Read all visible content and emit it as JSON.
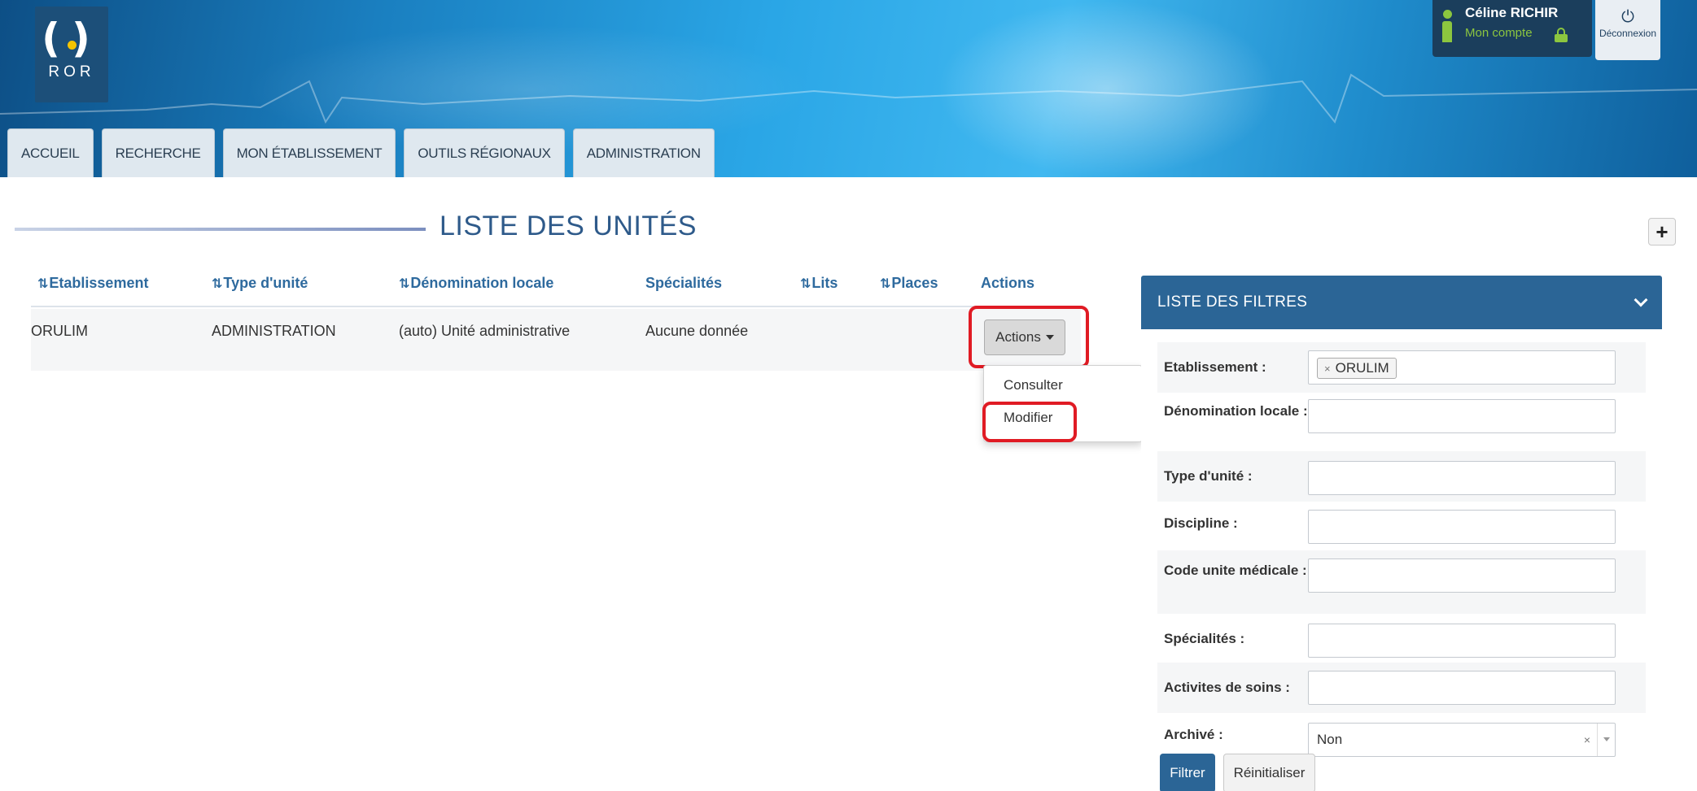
{
  "app": {
    "logo_text": "ROR"
  },
  "user": {
    "name": "Céline RICHIR",
    "account_label": "Mon compte",
    "logout_label": "Déconnexion"
  },
  "nav": {
    "tabs": [
      "ACCUEIL",
      "RECHERCHE",
      "MON ÉTABLISSEMENT",
      "OUTILS RÉGIONAUX",
      "ADMINISTRATION"
    ]
  },
  "page": {
    "title": "LISTE DES UNITÉS",
    "add_label": "+"
  },
  "table": {
    "columns": [
      "Etablissement",
      "Type d'unité",
      "Dénomination locale",
      "Spécialités",
      "Lits",
      "Places",
      "Actions"
    ],
    "rows": [
      {
        "etablissement": "ORULIM",
        "type": "ADMINISTRATION",
        "denomination": "(auto) Unité administrative",
        "specialites": "Aucune donnée",
        "lits": "",
        "places": ""
      }
    ],
    "actions_button": "Actions",
    "actions_menu": [
      "Consulter",
      "Modifier"
    ]
  },
  "filters": {
    "title": "LISTE DES FILTRES",
    "fields": [
      {
        "label": "Etablissement :",
        "value": "ORULIM"
      },
      {
        "label": "Dénomination locale :",
        "value": ""
      },
      {
        "label": "Type d'unité :",
        "value": ""
      },
      {
        "label": "Discipline :",
        "value": ""
      },
      {
        "label": "Code unite médicale :",
        "value": ""
      },
      {
        "label": "Spécialités :",
        "value": ""
      },
      {
        "label": "Activites de soins :",
        "value": ""
      },
      {
        "label": "Archivé :",
        "value": "Non"
      }
    ],
    "filter_button": "Filtrer",
    "reset_button": "Réinitialiser"
  },
  "colors": {
    "primary": "#2b6596",
    "highlight": "#e01b24",
    "accent_green": "#8cc63f"
  }
}
